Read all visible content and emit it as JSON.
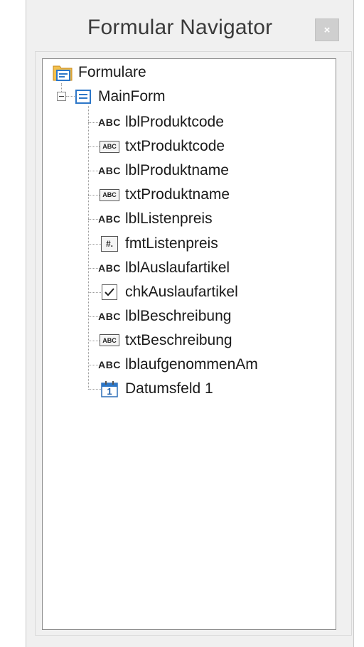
{
  "window": {
    "title": "Formular Navigator",
    "close_glyph": "×"
  },
  "tree": {
    "root": {
      "label": "Formulare",
      "icon": "folder-forms-icon"
    },
    "form": {
      "label": "MainForm",
      "icon": "form-icon",
      "expanded": true
    },
    "controls": [
      {
        "label": "lblProduktcode",
        "icon": "label-field-icon",
        "icon_text": "ABC"
      },
      {
        "label": "txtProduktcode",
        "icon": "text-box-icon",
        "icon_text": "ABC"
      },
      {
        "label": "lblProduktname",
        "icon": "label-field-icon",
        "icon_text": "ABC"
      },
      {
        "label": "txtProduktname",
        "icon": "text-box-icon",
        "icon_text": "ABC"
      },
      {
        "label": "lblListenpreis",
        "icon": "label-field-icon",
        "icon_text": "ABC"
      },
      {
        "label": "fmtListenpreis",
        "icon": "formatted-field-icon",
        "icon_text": "#."
      },
      {
        "label": "lblAuslaufartikel",
        "icon": "label-field-icon",
        "icon_text": "ABC"
      },
      {
        "label": "chkAuslaufartikel",
        "icon": "checkbox-icon",
        "icon_text": ""
      },
      {
        "label": "lblBeschreibung",
        "icon": "label-field-icon",
        "icon_text": "ABC"
      },
      {
        "label": "txtBeschreibung",
        "icon": "text-box-icon",
        "icon_text": "ABC"
      },
      {
        "label": "lblaufgenommenAm",
        "icon": "label-field-icon",
        "icon_text": "ABC"
      },
      {
        "label": "Datumsfeld 1",
        "icon": "date-field-icon",
        "icon_text": "1"
      }
    ]
  },
  "colors": {
    "accent_blue": "#2d77c8",
    "folder_orange": "#e8a33c",
    "panel_background": "#f0f0f0"
  }
}
